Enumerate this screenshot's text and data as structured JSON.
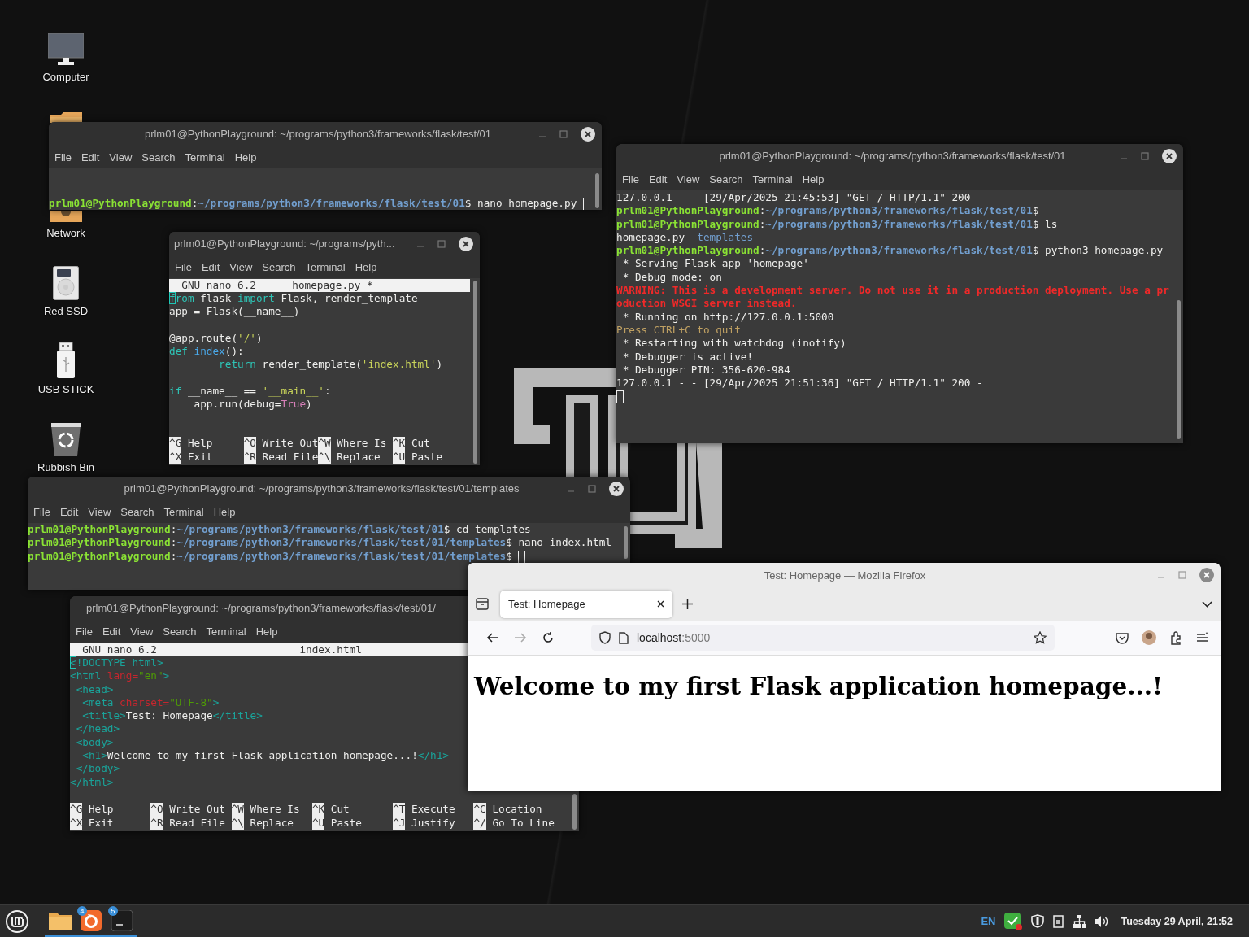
{
  "desktop_icons": [
    {
      "label": "Computer"
    },
    {
      "label": "Network"
    },
    {
      "label": "Red SSD"
    },
    {
      "label": "USB STICK"
    },
    {
      "label": "Rubbish Bin"
    }
  ],
  "windows": [
    {
      "kind": "terminal",
      "title": "prlm01@PythonPlayground: ~/programs/python3/frameworks/flask/test/01",
      "menu": [
        "File",
        "Edit",
        "View",
        "Search",
        "Terminal",
        "Help"
      ],
      "lines": [
        {
          "kind": "text",
          "cursor": true,
          "segments": [
            {
              "kind": "user",
              "text": "prlm01@PythonPlayground"
            },
            {
              "kind": "plain",
              "text": ":"
            },
            {
              "kind": "path",
              "text": "~/programs/python3/frameworks/flask/test/01"
            },
            {
              "kind": "plain",
              "text": "$ nano homepage.py"
            }
          ]
        }
      ]
    },
    {
      "kind": "nano",
      "title": "prlm01@PythonPlayground: ~/programs/pyth...",
      "menu": [
        "File",
        "Edit",
        "View",
        "Search",
        "Terminal",
        "Help"
      ],
      "header": {
        "version": "GNU nano 6.2",
        "file": "homepage.py *"
      },
      "lines": [
        {
          "kind": "text",
          "segments": [
            {
              "kind": "keyword",
              "text": "f",
              "cursor": true
            },
            {
              "kind": "keyword",
              "text": "rom"
            },
            {
              "kind": "plain",
              "text": " flask "
            },
            {
              "kind": "keyword",
              "text": "import"
            },
            {
              "kind": "plain",
              "text": " Flask, render_template"
            }
          ]
        },
        {
          "kind": "text",
          "segments": [
            {
              "kind": "plain",
              "text": "app = Flask(__name__)"
            }
          ]
        },
        {
          "kind": "blank"
        },
        {
          "kind": "text",
          "segments": [
            {
              "kind": "plain",
              "text": "@app.route("
            },
            {
              "kind": "string",
              "text": "'/'"
            },
            {
              "kind": "plain",
              "text": ")"
            }
          ]
        },
        {
          "kind": "text",
          "segments": [
            {
              "kind": "keyword",
              "text": "def "
            },
            {
              "kind": "function",
              "text": "index"
            },
            {
              "kind": "plain",
              "text": "():"
            }
          ]
        },
        {
          "kind": "text",
          "segments": [
            {
              "kind": "keyword",
              "text": "        return"
            },
            {
              "kind": "plain",
              "text": " render_template("
            },
            {
              "kind": "string",
              "text": "'index.html'"
            },
            {
              "kind": "plain",
              "text": ")"
            }
          ]
        },
        {
          "kind": "blank"
        },
        {
          "kind": "text",
          "segments": [
            {
              "kind": "keyword",
              "text": "if"
            },
            {
              "kind": "plain",
              "text": " __name__ == "
            },
            {
              "kind": "string",
              "text": "'__main__'"
            },
            {
              "kind": "plain",
              "text": ":"
            }
          ]
        },
        {
          "kind": "text",
          "segments": [
            {
              "kind": "plain",
              "text": "    app.run(debug="
            },
            {
              "kind": "constant",
              "text": "True"
            },
            {
              "kind": "plain",
              "text": ")"
            }
          ]
        }
      ],
      "shortcuts": [
        [
          {
            "key": "^G",
            "label": "Help"
          },
          {
            "key": "^O",
            "label": "Write Out"
          },
          {
            "key": "^W",
            "label": "Where Is"
          },
          {
            "key": "^K",
            "label": "Cut"
          }
        ],
        [
          {
            "key": "^X",
            "label": "Exit"
          },
          {
            "key": "^R",
            "label": "Read File"
          },
          {
            "key": "^\\",
            "label": "Replace"
          },
          {
            "key": "^U",
            "label": "Paste"
          }
        ]
      ]
    },
    {
      "kind": "terminal",
      "title": "prlm01@PythonPlayground: ~/programs/python3/frameworks/flask/test/01",
      "menu": [
        "File",
        "Edit",
        "View",
        "Search",
        "Terminal",
        "Help"
      ],
      "lines": [
        {
          "kind": "text",
          "segments": [
            {
              "kind": "plain",
              "text": "127.0.0.1 - - [29/Apr/2025 21:45:53] \"GET / HTTP/1.1\" 200 -"
            }
          ]
        },
        {
          "kind": "text",
          "segments": [
            {
              "kind": "user",
              "text": "prlm01@PythonPlayground"
            },
            {
              "kind": "plain",
              "text": ":"
            },
            {
              "kind": "path",
              "text": "~/programs/python3/frameworks/flask/test/01"
            },
            {
              "kind": "plain",
              "text": "$"
            }
          ]
        },
        {
          "kind": "text",
          "segments": [
            {
              "kind": "user",
              "text": "prlm01@PythonPlayground"
            },
            {
              "kind": "plain",
              "text": ":"
            },
            {
              "kind": "path",
              "text": "~/programs/python3/frameworks/flask/test/01"
            },
            {
              "kind": "plain",
              "text": "$ ls"
            }
          ]
        },
        {
          "kind": "text",
          "segments": [
            {
              "kind": "plain",
              "text": "homepage.py  "
            },
            {
              "kind": "dir",
              "text": "templates"
            }
          ]
        },
        {
          "kind": "text",
          "segments": [
            {
              "kind": "user",
              "text": "prlm01@PythonPlayground"
            },
            {
              "kind": "plain",
              "text": ":"
            },
            {
              "kind": "path",
              "text": "~/programs/python3/frameworks/flask/test/01"
            },
            {
              "kind": "plain",
              "text": "$ python3 homepage.py"
            }
          ]
        },
        {
          "kind": "text",
          "segments": [
            {
              "kind": "plain",
              "text": " * Serving Flask app 'homepage'"
            }
          ]
        },
        {
          "kind": "text",
          "segments": [
            {
              "kind": "plain",
              "text": " * Debug mode: on"
            }
          ]
        },
        {
          "kind": "text",
          "segments": [
            {
              "kind": "warning",
              "text": "WARNING: This is a development server. Do not use it in a production deployment. Use a pr"
            }
          ]
        },
        {
          "kind": "text",
          "segments": [
            {
              "kind": "warning",
              "text": "oduction WSGI server instead."
            }
          ]
        },
        {
          "kind": "text",
          "segments": [
            {
              "kind": "plain",
              "text": " * Running on http://127.0.0.1:5000"
            }
          ]
        },
        {
          "kind": "text",
          "segments": [
            {
              "kind": "notice",
              "text": "Press CTRL+C to quit"
            }
          ]
        },
        {
          "kind": "text",
          "segments": [
            {
              "kind": "plain",
              "text": " * Restarting with watchdog (inotify)"
            }
          ]
        },
        {
          "kind": "text",
          "segments": [
            {
              "kind": "plain",
              "text": " * Debugger is active!"
            }
          ]
        },
        {
          "kind": "text",
          "segments": [
            {
              "kind": "plain",
              "text": " * Debugger PIN: 356-620-984"
            }
          ]
        },
        {
          "kind": "text",
          "segments": [
            {
              "kind": "plain",
              "text": "127.0.0.1 - - [29/Apr/2025 21:51:36] \"GET / HTTP/1.1\" 200 -"
            }
          ]
        },
        {
          "kind": "cursor"
        }
      ]
    },
    {
      "kind": "terminal",
      "title": "prlm01@PythonPlayground: ~/programs/python3/frameworks/flask/test/01/templates",
      "menu": [
        "File",
        "Edit",
        "View",
        "Search",
        "Terminal",
        "Help"
      ],
      "lines": [
        {
          "kind": "text",
          "segments": [
            {
              "kind": "user",
              "text": "prlm01@PythonPlayground"
            },
            {
              "kind": "plain",
              "text": ":"
            },
            {
              "kind": "path",
              "text": "~/programs/python3/frameworks/flask/test/01"
            },
            {
              "kind": "plain",
              "text": "$ cd templates"
            }
          ]
        },
        {
          "kind": "text",
          "segments": [
            {
              "kind": "user",
              "text": "prlm01@PythonPlayground"
            },
            {
              "kind": "plain",
              "text": ":"
            },
            {
              "kind": "path",
              "text": "~/programs/python3/frameworks/flask/test/01/templates"
            },
            {
              "kind": "plain",
              "text": "$ nano index.html"
            }
          ]
        },
        {
          "kind": "text",
          "cursor": true,
          "segments": [
            {
              "kind": "user",
              "text": "prlm01@PythonPlayground"
            },
            {
              "kind": "plain",
              "text": ":"
            },
            {
              "kind": "path",
              "text": "~/programs/python3/frameworks/flask/test/01/templates"
            },
            {
              "kind": "plain",
              "text": "$ "
            }
          ]
        }
      ]
    },
    {
      "kind": "nano",
      "title": "prlm01@PythonPlayground: ~/programs/python3/frameworks/flask/test/01/",
      "menu": [
        "File",
        "Edit",
        "View",
        "Search",
        "Terminal",
        "Help"
      ],
      "header": {
        "version": "GNU nano 6.2",
        "file": "index.html"
      },
      "lines": [
        {
          "kind": "text",
          "segments": [
            {
              "kind": "tag",
              "text": "<",
              "cursor": true
            },
            {
              "kind": "tag",
              "text": "!DOCTYPE html>"
            }
          ]
        },
        {
          "kind": "text",
          "segments": [
            {
              "kind": "tag",
              "text": "<html "
            },
            {
              "kind": "attr",
              "text": "lang="
            },
            {
              "kind": "value",
              "text": "\"en\""
            },
            {
              "kind": "tag",
              "text": ">"
            }
          ]
        },
        {
          "kind": "text",
          "segments": [
            {
              "kind": "tag",
              "text": " <head>"
            }
          ]
        },
        {
          "kind": "text",
          "segments": [
            {
              "kind": "tag",
              "text": "  <meta "
            },
            {
              "kind": "attr",
              "text": "charset="
            },
            {
              "kind": "value",
              "text": "\"UTF-8\""
            },
            {
              "kind": "tag",
              "text": ">"
            }
          ]
        },
        {
          "kind": "text",
          "segments": [
            {
              "kind": "tag",
              "text": "  <title>"
            },
            {
              "kind": "plain",
              "text": "Test: Homepage"
            },
            {
              "kind": "tag",
              "text": "</title>"
            }
          ]
        },
        {
          "kind": "text",
          "segments": [
            {
              "kind": "tag",
              "text": " </head>"
            }
          ]
        },
        {
          "kind": "text",
          "segments": [
            {
              "kind": "tag",
              "text": " <body>"
            }
          ]
        },
        {
          "kind": "text",
          "segments": [
            {
              "kind": "tag",
              "text": "  <h1>"
            },
            {
              "kind": "plain",
              "text": "Welcome to my first Flask application homepage...!"
            },
            {
              "kind": "tag",
              "text": "</h1>"
            }
          ]
        },
        {
          "kind": "text",
          "segments": [
            {
              "kind": "tag",
              "text": " </body>"
            }
          ]
        },
        {
          "kind": "text",
          "segments": [
            {
              "kind": "tag",
              "text": "</html>"
            }
          ]
        }
      ],
      "shortcuts": [
        [
          {
            "key": "^G",
            "label": "Help"
          },
          {
            "key": "^O",
            "label": "Write Out"
          },
          {
            "key": "^W",
            "label": "Where Is"
          },
          {
            "key": "^K",
            "label": "Cut"
          },
          {
            "key": "^T",
            "label": "Execute"
          },
          {
            "key": "^C",
            "label": "Location"
          }
        ],
        [
          {
            "key": "^X",
            "label": "Exit"
          },
          {
            "key": "^R",
            "label": "Read File"
          },
          {
            "key": "^\\",
            "label": "Replace"
          },
          {
            "key": "^U",
            "label": "Paste"
          },
          {
            "key": "^J",
            "label": "Justify"
          },
          {
            "key": "^/",
            "label": "Go To Line"
          }
        ]
      ]
    }
  ],
  "browser": {
    "title": "Test: Homepage — Mozilla Firefox",
    "tabs": [
      {
        "label": "Test: Homepage",
        "selected": true
      }
    ],
    "nav": [
      {
        "disabled": false
      },
      {
        "disabled": true
      },
      {
        "disabled": false
      }
    ],
    "url": {
      "host": "localhost",
      "port": ":5000"
    },
    "heading": "Welcome to my first Flask application homepage...!"
  },
  "taskbar": {
    "apps": [
      {
        "active": true
      },
      {
        "active": true,
        "badge": "4"
      },
      {
        "active": true,
        "badge": "5"
      }
    ],
    "language": "EN",
    "clock": "Tuesday 29 April, 21:52"
  }
}
